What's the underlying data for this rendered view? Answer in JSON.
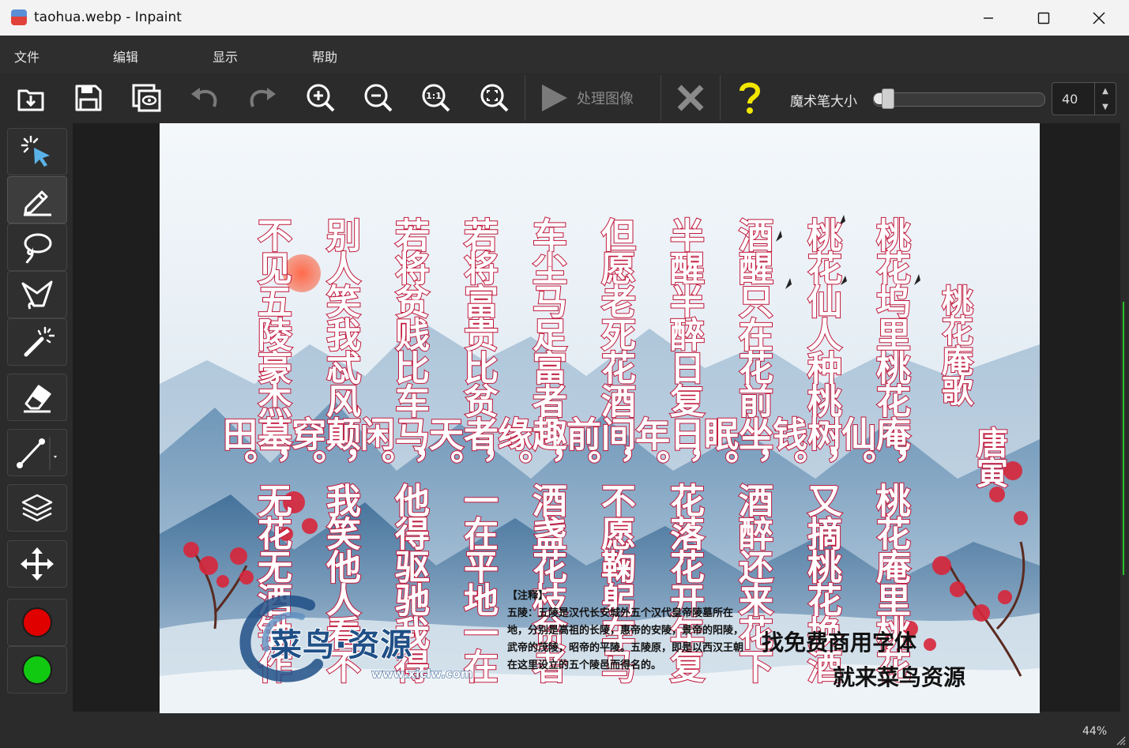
{
  "window": {
    "title": "taohua.webp - Inpaint",
    "controls": [
      "minimize",
      "maximize",
      "close"
    ]
  },
  "menu": [
    "文件",
    "编辑",
    "显示",
    "帮助"
  ],
  "toolbar": {
    "buttons": [
      {
        "name": "open-icon"
      },
      {
        "name": "save-icon"
      },
      {
        "name": "preview-icon"
      },
      {
        "name": "undo-icon"
      },
      {
        "name": "redo-icon"
      },
      {
        "name": "zoom-in-icon"
      },
      {
        "name": "zoom-out-icon"
      },
      {
        "name": "actual-size-icon",
        "label": "1:1"
      },
      {
        "name": "fit-window-icon"
      }
    ],
    "process_label": "处理图像",
    "cancel_icon": "x-icon",
    "help_icon": "question-icon",
    "brush_size_label": "魔术笔大小",
    "brush_size_value": "40",
    "brush_size_fraction": 0.05
  },
  "tools": [
    {
      "name": "select-tool",
      "icon": "pointer-sparkle-icon",
      "active": false
    },
    {
      "name": "marker-tool",
      "icon": "pencil-icon",
      "active": true
    },
    {
      "name": "lasso-tool",
      "icon": "lasso-icon",
      "active": false
    },
    {
      "name": "polygon-lasso-tool",
      "icon": "polygon-lasso-icon",
      "active": false
    },
    {
      "name": "magic-wand-tool",
      "icon": "magic-wand-icon",
      "active": false
    },
    {
      "name": "eraser-tool",
      "icon": "eraser-icon",
      "active": false
    },
    {
      "name": "line-tool",
      "icon": "line-icon",
      "active": false
    },
    {
      "name": "layers-tool",
      "icon": "layers-icon",
      "active": false
    },
    {
      "name": "move-tool",
      "icon": "move-icon",
      "active": false
    }
  ],
  "colors": {
    "foreground": "#e00000",
    "background": "#12c912",
    "poem_stroke": "#c0163a",
    "logo_blue": "#1f4f86"
  },
  "image": {
    "poem_title": "桃花庵歌",
    "author": "唐寅",
    "columns": [
      "桃花坞里桃花庵，桃花庵里桃花仙。",
      "桃花仙人种桃树，又摘桃花换酒钱。",
      "酒醒只在花前坐，酒醉还来花下眠。",
      "半醒半醉日复日，花落花开年复年。",
      "但愿老死花酒间，不愿鞠躬车马前。",
      "车尘马足富者趣，酒盏花枝贫者缘。",
      "若将富贵比贫者，一在平地一在天。",
      "若将贫贱比车马，他得驱驰我得闲。",
      "别人笑我忒风颠，我笑他人看不穿。",
      "不见五陵豪杰墓，无花无酒锄作田。"
    ],
    "note_title": "【注释】",
    "note_body": "五陵：五陵是汉代长安城外五个汉代皇帝陵墓所在地，分别是高祖的长陵，惠帝的安陵，景帝的阳陵，武帝的茂陵，昭帝的平陵。五陵原，即是以西汉王朝在这里设立的五个陵邑而得名的。",
    "slogan_line1": "找免费商用字体",
    "slogan_line2": "就来菜鸟资源",
    "logo_text": "菜鸟·资源",
    "logo_url": "www.xiclw.com"
  },
  "status": {
    "zoom": "44%"
  }
}
